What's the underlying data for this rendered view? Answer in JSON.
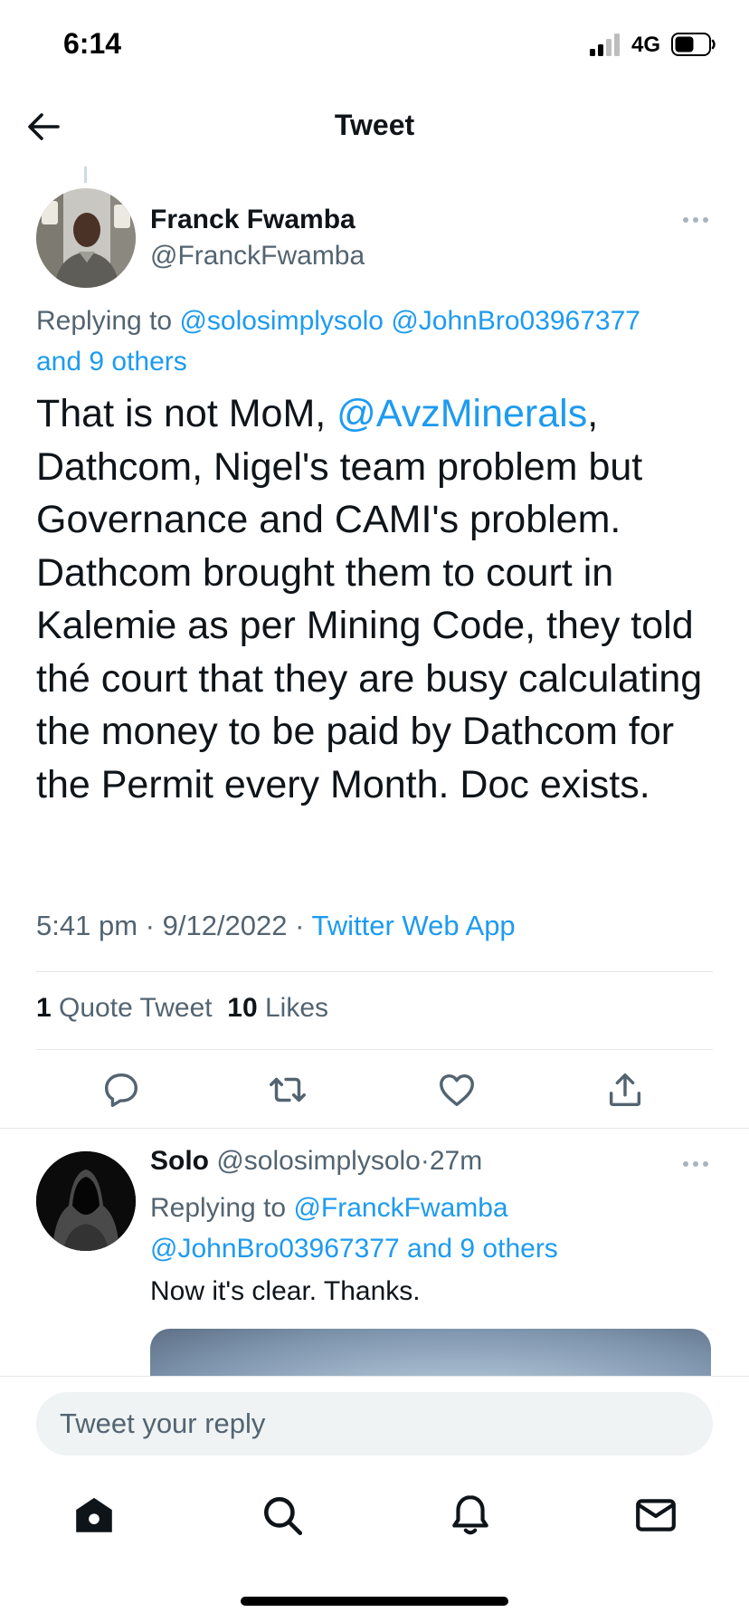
{
  "status_bar": {
    "time": "6:14",
    "network": "4G"
  },
  "header": {
    "title": "Tweet"
  },
  "main_tweet": {
    "author_name": "Franck Fwamba",
    "author_handle": "@FranckFwamba",
    "replying_prefix": "Replying to",
    "replying_to_1": "@solosimplysolo",
    "replying_to_2": "@JohnBro03967377",
    "replying_others": "and 9 others",
    "text_1": "That is not MoM, ",
    "mention": "@AvzMinerals",
    "text_2": ", Dathcom, Nigel's team problem but Governance and CAMI's problem. Dathcom brought them to court in Kalemie as per Mining Code, they told thé court that they are busy calculating the money to be paid by Dathcom for the Permit every Month. Doc exists.",
    "time": "5:41 pm",
    "date": "9/12/2022",
    "separator": "·",
    "source": "Twitter Web App",
    "quote_count": "1",
    "quote_label": "Quote Tweet",
    "like_count": "10",
    "like_label": "Likes"
  },
  "reply_tweet": {
    "author_name": "Solo",
    "author_handle": "@solosimplysolo",
    "separator": "·",
    "time_ago": "27m",
    "replying_prefix": "Replying to",
    "replying_to_1": "@FranckFwamba",
    "replying_to_2": "@JohnBro03967377",
    "replying_others": "and 9 others",
    "text": "Now it's clear. Thanks."
  },
  "compose": {
    "placeholder": "Tweet your reply"
  },
  "icons": {
    "back": "arrow-left-icon",
    "more": "more-horizontal-icon",
    "reply": "comment-icon",
    "retweet": "retweet-icon",
    "like": "heart-icon",
    "share": "share-icon",
    "tabs": [
      "home-icon",
      "search-icon",
      "bell-icon",
      "mail-icon"
    ]
  },
  "colors": {
    "accent": "#1d9bf0",
    "text": "#0f1419",
    "secondary": "#536471"
  }
}
